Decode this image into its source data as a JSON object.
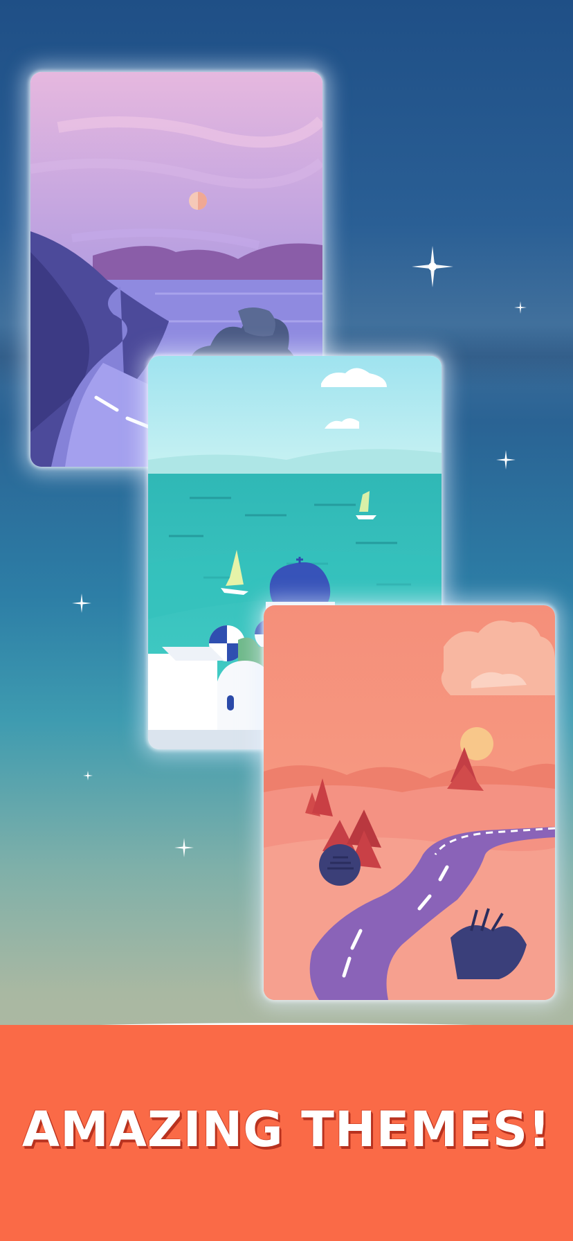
{
  "headline": "AMAZING THEMES!",
  "themes": [
    {
      "name": "purple-coast-theme"
    },
    {
      "name": "santorini-sea-theme"
    },
    {
      "name": "desert-sunset-theme"
    }
  ],
  "colors": {
    "banner": "#fa6a47",
    "headline_text": "#ffffff",
    "headline_shadow": "#b8321f"
  }
}
